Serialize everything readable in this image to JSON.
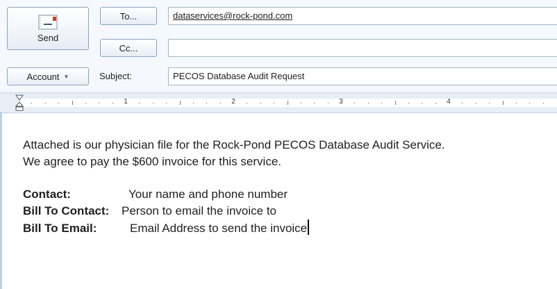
{
  "header": {
    "send_label": "Send",
    "to_label": "To...",
    "cc_label": "Cc...",
    "account_label": "Account",
    "subject_label": "Subject:",
    "to_value": "dataservices@rock-pond.com",
    "cc_value": "",
    "subject_value": "PECOS Database Audit Request"
  },
  "ruler": {
    "numbers": [
      "1",
      "2",
      "3",
      "4"
    ]
  },
  "body": {
    "line1": "Attached is our physician file for the Rock-Pond PECOS Database Audit Service.",
    "line2": "We agree to pay the $600 invoice for this service.",
    "contact_label": "Contact:",
    "contact_value": "Your name and phone number",
    "bill_to_contact_label": "Bill To Contact:",
    "bill_to_contact_value": "Person to email the invoice to",
    "bill_to_email_label": "Bill To Email:",
    "bill_to_email_value": "Email Address to send the invoice"
  },
  "icons": {
    "send": "envelope-send-icon",
    "account_caret": "caret-down-icon",
    "indent": "indent-marker-icon"
  },
  "colors": {
    "header_bg": "#f5f8fc",
    "button_border": "#8fa3bf",
    "ruler_bg": "#e8eef6",
    "text": "#1f1f1f"
  }
}
